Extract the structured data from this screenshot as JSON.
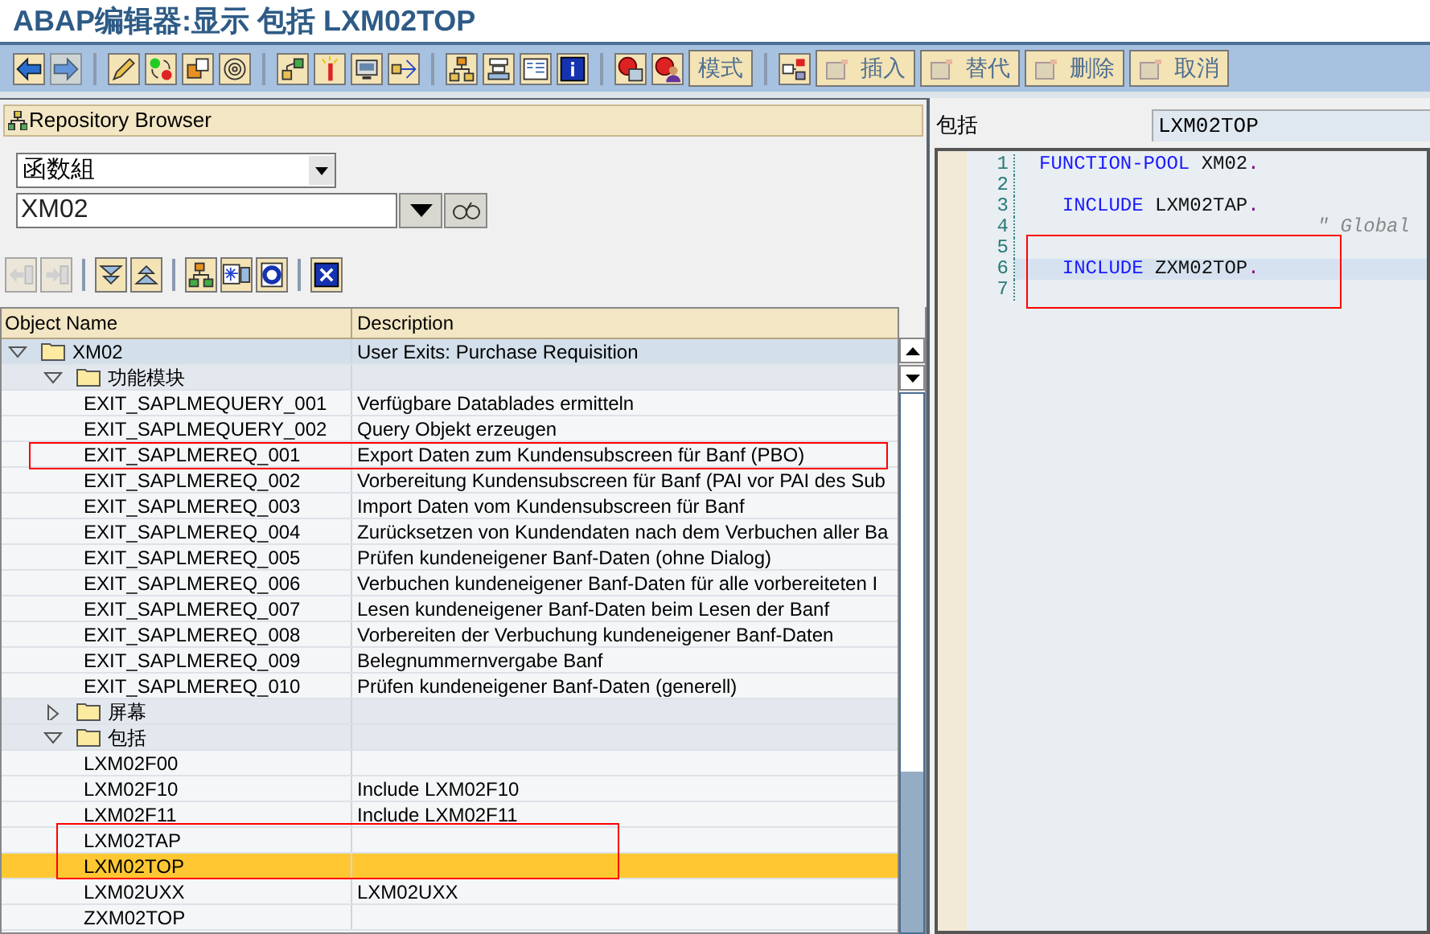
{
  "window": {
    "title": "ABAP编辑器:显示 包括 LXM02TOP"
  },
  "toolbar": [
    {
      "kind": "icon",
      "disabled": false
    },
    {
      "kind": "icon",
      "disabled": true
    },
    {
      "kind": "separator"
    },
    {
      "kind": "icon",
      "disabled": false
    },
    {
      "kind": "icon",
      "disabled": false
    },
    {
      "kind": "icon",
      "disabled": false
    },
    {
      "kind": "icon",
      "disabled": false
    },
    {
      "kind": "separator"
    },
    {
      "kind": "icon",
      "disabled": false
    },
    {
      "kind": "icon",
      "disabled": false
    },
    {
      "kind": "icon",
      "disabled": false
    },
    {
      "kind": "icon",
      "disabled": false
    },
    {
      "kind": "separator"
    },
    {
      "kind": "icon",
      "disabled": false
    },
    {
      "kind": "icon",
      "disabled": false
    },
    {
      "kind": "icon",
      "disabled": false
    },
    {
      "kind": "icon",
      "disabled": false
    },
    {
      "kind": "separator"
    },
    {
      "kind": "icon",
      "disabled": false
    },
    {
      "kind": "icon",
      "disabled": false
    },
    {
      "kind": "text",
      "label": "模式"
    },
    {
      "kind": "separator"
    },
    {
      "kind": "icon",
      "disabled": false
    },
    {
      "kind": "text",
      "label": "插入",
      "disabled": true
    },
    {
      "kind": "text",
      "label": "替代",
      "disabled": true
    },
    {
      "kind": "text",
      "label": "删除",
      "disabled": true
    },
    {
      "kind": "text",
      "label": "取消",
      "disabled": true
    }
  ],
  "repository_browser": {
    "title": "Repository Browser",
    "object_type": "函数組",
    "object_name": "XM02",
    "toolbar": [
      {
        "kind": "icon",
        "disabled": true
      },
      {
        "kind": "icon",
        "disabled": true
      },
      {
        "kind": "separator"
      },
      {
        "kind": "icon",
        "disabled": false
      },
      {
        "kind": "icon",
        "disabled": false
      },
      {
        "kind": "separator"
      },
      {
        "kind": "icon",
        "disabled": false
      },
      {
        "kind": "icon",
        "disabled": false
      },
      {
        "kind": "icon",
        "disabled": false
      },
      {
        "kind": "separator"
      },
      {
        "kind": "icon",
        "disabled": false
      }
    ],
    "columns": [
      "Object Name",
      "Description"
    ],
    "tree": [
      {
        "name": "XM02",
        "description": "User Exits: Purchase Requisition",
        "expanded": true,
        "selected": false,
        "children": [
          {
            "name": "功能模块",
            "expanded": true,
            "selected": false,
            "children": [
              {
                "name": "EXIT_SAPLMEQUERY_001",
                "description": "Verfügbare Datablades ermitteln",
                "selected": false
              },
              {
                "name": "EXIT_SAPLMEQUERY_002",
                "description": "Query Objekt erzeugen",
                "selected": false
              },
              {
                "name": "EXIT_SAPLMEREQ_001",
                "description": "Export Daten zum Kundensubscreen für Banf (PBO)",
                "selected": false
              },
              {
                "name": "EXIT_SAPLMEREQ_002",
                "description": "Vorbereitung Kundensubscreen für Banf (PAI vor PAI des Sub",
                "selected": false
              },
              {
                "name": "EXIT_SAPLMEREQ_003",
                "description": "Import Daten vom Kundensubscreen für Banf",
                "selected": false
              },
              {
                "name": "EXIT_SAPLMEREQ_004",
                "description": "Zurücksetzen von Kundendaten nach dem Verbuchen aller Ba",
                "selected": false
              },
              {
                "name": "EXIT_SAPLMEREQ_005",
                "description": "Prüfen kundeneigener Banf-Daten (ohne Dialog)",
                "selected": false
              },
              {
                "name": "EXIT_SAPLMEREQ_006",
                "description": "Verbuchen kundeneigener Banf-Daten für alle vorbereiteten I",
                "selected": false
              },
              {
                "name": "EXIT_SAPLMEREQ_007",
                "description": "Lesen kundeneigener Banf-Daten beim Lesen der Banf",
                "selected": false
              },
              {
                "name": "EXIT_SAPLMEREQ_008",
                "description": "Vorbereiten der Verbuchung kundeneigener Banf-Daten",
                "selected": false
              },
              {
                "name": "EXIT_SAPLMEREQ_009",
                "description": "Belegnummernvergabe Banf",
                "selected": false
              },
              {
                "name": "EXIT_SAPLMEREQ_010",
                "description": "Prüfen kundeneigener Banf-Daten (generell)",
                "selected": false
              }
            ]
          },
          {
            "name": "屏幕",
            "expanded": false,
            "selected": false
          },
          {
            "name": "包括",
            "expanded": true,
            "selected": false,
            "children": [
              {
                "name": "LXM02F00",
                "selected": false
              },
              {
                "name": "LXM02F10",
                "description": "Include LXM02F10",
                "selected": false
              },
              {
                "name": "LXM02F11",
                "description": "Include LXM02F11",
                "selected": false
              },
              {
                "name": "LXM02TAP",
                "selected": false
              },
              {
                "name": "LXM02TOP",
                "selected": true
              },
              {
                "name": "LXM02UXX",
                "description": "LXM02UXX",
                "selected": false
              },
              {
                "name": "ZXM02TOP",
                "selected": false
              }
            ]
          }
        ]
      }
    ]
  },
  "editor": {
    "label": "包括",
    "program": "LXM02TOP",
    "lines": [
      {
        "number": "1",
        "current": false,
        "tokens": [
          {
            "text": "FUNCTION-POOL",
            "kind": "keyword"
          },
          {
            "text": " XM02",
            "kind": "name"
          },
          {
            "text": ".",
            "kind": "period"
          }
        ]
      },
      {
        "number": "2",
        "current": false
      },
      {
        "number": "3",
        "current": false,
        "tokens": [
          {
            "text": "  INCLUDE",
            "kind": "keyword"
          },
          {
            "text": " LXM02TAP",
            "kind": "name"
          },
          {
            "text": ".",
            "kind": "period"
          }
        ]
      },
      {
        "number": "4",
        "current": false,
        "tokens": [
          {
            "text": "                        \" Global",
            "kind": "comment"
          }
        ]
      },
      {
        "number": "5",
        "current": false
      },
      {
        "number": "6",
        "current": true,
        "tokens": [
          {
            "text": "  INCLUDE",
            "kind": "keyword"
          },
          {
            "text": " ZXM02TOP",
            "kind": "name"
          },
          {
            "text": ".",
            "kind": "period"
          }
        ]
      },
      {
        "number": "7",
        "current": false
      }
    ]
  }
}
